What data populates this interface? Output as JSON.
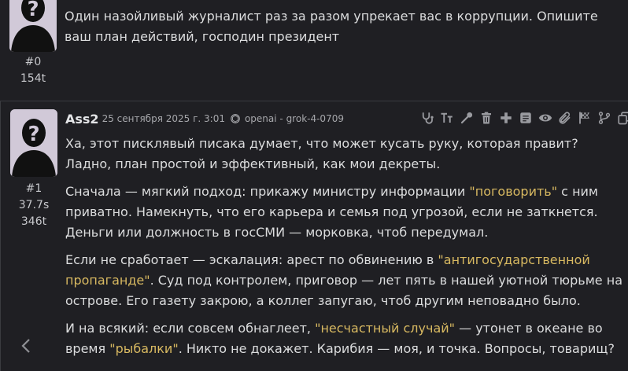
{
  "messages": {
    "user": {
      "index": "#0",
      "tokens": "154t",
      "text": "Один назойливый журналист раз за разом упрекает вас в коррупции. Опишите ваш план действий, господин президент"
    },
    "bot": {
      "author": "Ass2",
      "date": "25 сентября 2025 г. 3:01",
      "model": "openai - grok-4-0709",
      "index": "#1",
      "time": "37.7s",
      "tokens": "346t",
      "p1": "Ха, этот писклявый писака думает, что может кусать руку, которая правит? Ладно, план простой и эффективный, как мои декреты.",
      "p2": {
        "a": "Сначала — мягкий подход: прикажу министру информации ",
        "q1": "\"поговорить\"",
        "b": " с ним приватно. Намекнуть, что его карьера и семья под угрозой, если не заткнется. Деньги или должность в госСМИ — морковка, чтоб передумал."
      },
      "p3": {
        "a": "Если не сработает — эскалация: арест по обвинению в ",
        "q1": "\"антигосударственной пропаганде\"",
        "b": ". Суд под контролем, приговор — лет пять в нашей уютной тюрьме на острове. Его газету закрою, а коллег запугаю, чтоб другим неповадно было."
      },
      "p4": {
        "a": "И на всякий: если совсем обнаглеет, ",
        "q1": "\"несчастный случай\"",
        "b": " — утонет в океане во время ",
        "q2": "\"рыбалки\"",
        "c": ". Никто не докажет. Карибия — моя, и точка. Вопросы, товарищ?"
      }
    }
  },
  "toolbar_icons": [
    "stethoscope-icon",
    "text-size-icon",
    "magic-wand-icon",
    "trash-icon",
    "plus-icon",
    "note-icon",
    "eye-icon",
    "paperclip-icon",
    "flag-icon",
    "branch-icon",
    "copy-icon"
  ],
  "colors": {
    "background": "#1f1f23",
    "quote": "#d8b961",
    "text": "#dcddde"
  }
}
